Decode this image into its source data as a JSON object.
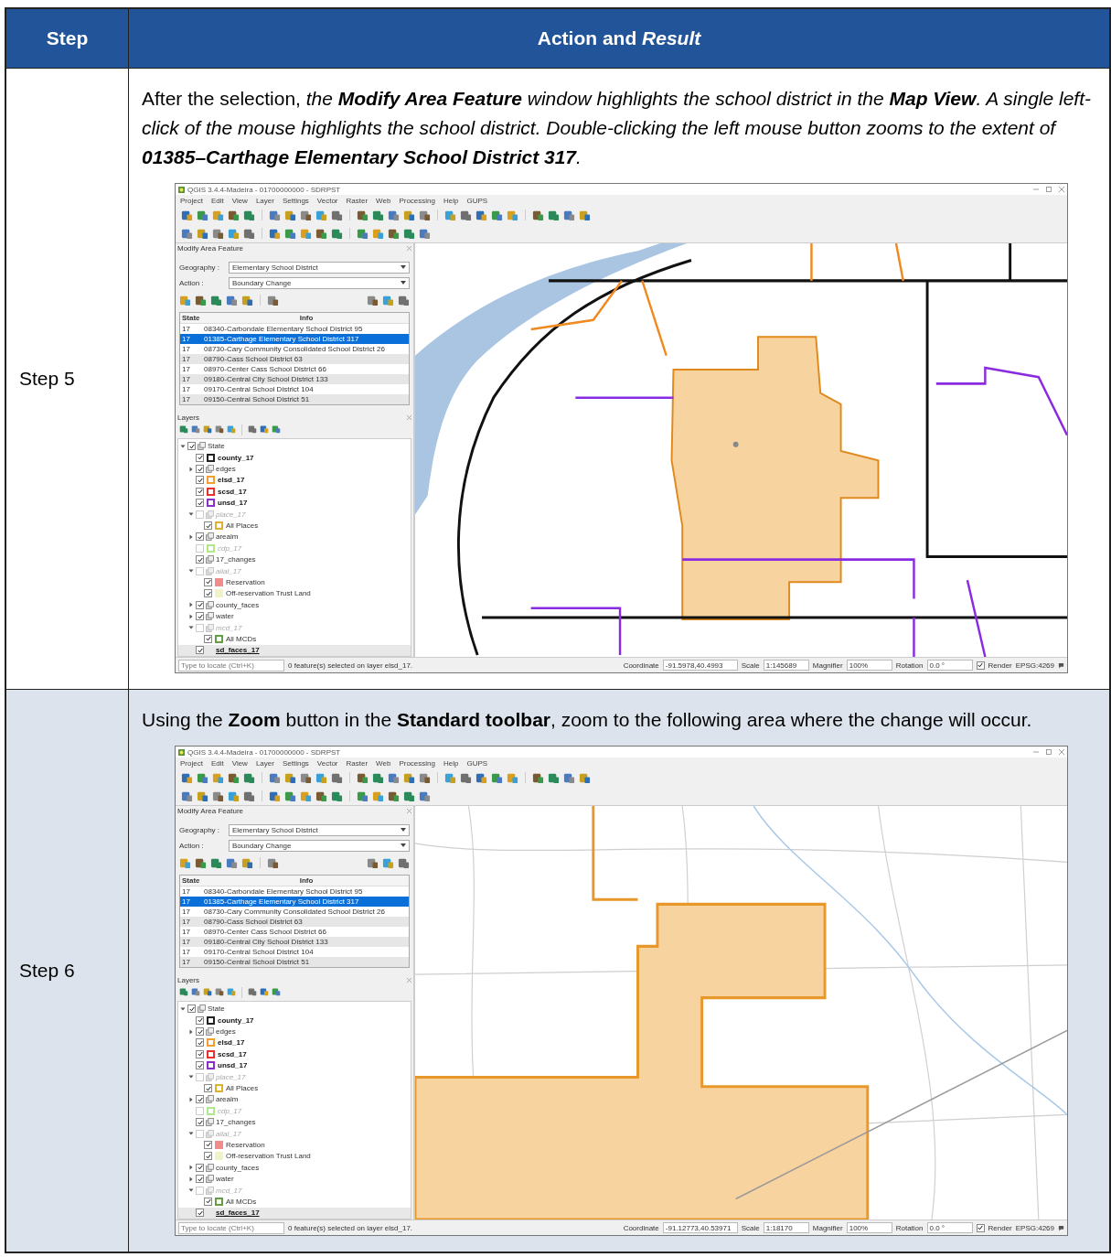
{
  "header": {
    "step": "Step",
    "action": "Action and *Result*"
  },
  "steps": [
    {
      "label": "Step 5",
      "shaded": false,
      "text": [
        {
          "text": "After the selection, ",
          "bold": false,
          "italic": false
        },
        {
          "text": "the ",
          "bold": false,
          "italic": true
        },
        {
          "text": "Modify Area Feature",
          "bold": true,
          "italic": true
        },
        {
          "text": " window highlights the school district in the ",
          "bold": false,
          "italic": true
        },
        {
          "text": "Map View",
          "bold": true,
          "italic": true
        },
        {
          "text": ". A single left-click of the mouse highlights the school district. Double-clicking the left mouse button zooms to the extent of ",
          "bold": false,
          "italic": true
        },
        {
          "text": "01385–Carthage Elementary School District 317",
          "bold": true,
          "italic": true
        },
        {
          "text": ".",
          "bold": false,
          "italic": true
        }
      ],
      "screenshot": {
        "window_title": "QGIS 3.4.4-Madeira - 01700000000 - SDRPST",
        "menu": [
          "Project",
          "Edit",
          "View",
          "Layer",
          "Settings",
          "Vector",
          "Raster",
          "Web",
          "Processing",
          "Help",
          "GUPS"
        ],
        "dock_title": "Modify Area Feature",
        "geography_label": "Geography :",
        "geography": "Elementary School District",
        "action_label": "Action :",
        "action": "Boundary Change",
        "columns": [
          "State",
          "Info"
        ],
        "rows": [
          {
            "state": "17",
            "info": "08340-Carbondale Elementary School District 95",
            "selected": false
          },
          {
            "state": "17",
            "info": "01385-Carthage Elementary School District 317",
            "selected": true
          },
          {
            "state": "17",
            "info": "08730-Cary Community Consolidated School District 26",
            "selected": false
          },
          {
            "state": "17",
            "info": "08790-Cass School District 63",
            "selected": false
          },
          {
            "state": "17",
            "info": "08970-Center Cass School District 66",
            "selected": false
          },
          {
            "state": "17",
            "info": "09180-Central City School District 133",
            "selected": false
          },
          {
            "state": "17",
            "info": "09170-Central School District 104",
            "selected": false
          },
          {
            "state": "17",
            "info": "09150-Central School District 51",
            "selected": false
          }
        ],
        "layers_title": "Layers",
        "layers": [
          {
            "name": "State",
            "kind": "group",
            "checked": true,
            "expanded": true,
            "enabled": true,
            "bold": false,
            "selected": false,
            "children": [
              {
                "name": "county_17",
                "kind": "symbol",
                "color": "#222222",
                "filled": false,
                "checked": true,
                "enabled": true,
                "bold": true,
                "selected": false
              },
              {
                "name": "edges",
                "kind": "group",
                "checked": true,
                "expanded": false,
                "enabled": true,
                "bold": false,
                "selected": false
              },
              {
                "name": "elsd_17",
                "kind": "symbol",
                "color": "#f0a030",
                "filled": false,
                "checked": true,
                "enabled": true,
                "bold": true,
                "selected": false
              },
              {
                "name": "scsd_17",
                "kind": "symbol",
                "color": "#e83030",
                "filled": false,
                "checked": true,
                "enabled": true,
                "bold": true,
                "selected": false
              },
              {
                "name": "unsd_17",
                "kind": "symbol",
                "color": "#8a30c8",
                "filled": false,
                "checked": true,
                "enabled": true,
                "bold": true,
                "selected": false
              },
              {
                "name": "place_17",
                "kind": "group",
                "checked": false,
                "expanded": true,
                "enabled": false,
                "bold": false,
                "selected": false,
                "children": [
                  {
                    "name": "All Places",
                    "kind": "symbol",
                    "color": "#e0b030",
                    "filled": false,
                    "checked": true,
                    "enabled": true,
                    "bold": false,
                    "selected": false
                  }
                ]
              },
              {
                "name": "arealm",
                "kind": "group",
                "checked": true,
                "expanded": false,
                "enabled": true,
                "bold": false,
                "selected": false
              },
              {
                "name": "cdp_17",
                "kind": "symbol",
                "color": "#b0e890",
                "filled": false,
                "checked": false,
                "enabled": false,
                "bold": false,
                "selected": false
              },
              {
                "name": "17_changes",
                "kind": "group",
                "checked": true,
                "enabled": true,
                "bold": false,
                "selected": false
              },
              {
                "name": "aiial_17",
                "kind": "group",
                "checked": false,
                "expanded": true,
                "enabled": false,
                "bold": false,
                "selected": false,
                "children": [
                  {
                    "name": "Reservation",
                    "kind": "symbol",
                    "color": "#f08c8c",
                    "filled": true,
                    "checked": true,
                    "enabled": true,
                    "bold": false,
                    "selected": false
                  },
                  {
                    "name": "Off-reservation Trust Land",
                    "kind": "symbol",
                    "color": "#f2f2c8",
                    "filled": true,
                    "checked": true,
                    "enabled": true,
                    "bold": false,
                    "selected": false
                  }
                ]
              },
              {
                "name": "county_faces",
                "kind": "group",
                "checked": true,
                "expanded": false,
                "enabled": true,
                "bold": false,
                "selected": false
              },
              {
                "name": "water",
                "kind": "group",
                "checked": true,
                "expanded": false,
                "enabled": true,
                "bold": false,
                "selected": false
              },
              {
                "name": "mcd_17",
                "kind": "group",
                "checked": false,
                "expanded": true,
                "enabled": false,
                "bold": false,
                "selected": false,
                "children": [
                  {
                    "name": "All MCDs",
                    "kind": "symbol",
                    "color": "#60a040",
                    "filled": false,
                    "checked": true,
                    "enabled": true,
                    "bold": false,
                    "selected": false
                  }
                ]
              },
              {
                "name": "sd_faces_17",
                "kind": "plain",
                "checked": true,
                "enabled": true,
                "bold": true,
                "selected": true
              }
            ]
          }
        ],
        "status": {
          "locate_placeholder": "Type to locate (Ctrl+K)",
          "message": "0 feature(s) selected on layer elsd_17.",
          "coordinate_label": "Coordinate",
          "coordinate": "-91.5978,40.4993",
          "scale_label": "Scale",
          "scale": "1:145689",
          "magnifier_label": "Magnifier",
          "magnifier": "100%",
          "rotation_label": "Rotation",
          "rotation": "0.0 °",
          "render_label": "Render",
          "render_checked": true,
          "crs": "EPSG:4269"
        }
      }
    },
    {
      "label": "Step 6",
      "shaded": true,
      "text": [
        {
          "text": "Using the ",
          "bold": false,
          "italic": false
        },
        {
          "text": "Zoom",
          "bold": true,
          "italic": false
        },
        {
          "text": " button in the ",
          "bold": false,
          "italic": false
        },
        {
          "text": "Standard toolbar",
          "bold": true,
          "italic": false
        },
        {
          "text": ", zoom to the following area where the change will occur.",
          "bold": false,
          "italic": false
        }
      ],
      "screenshot": {
        "window_title": "QGIS 3.4.4-Madeira - 01700000000 - SDRPST",
        "menu": [
          "Project",
          "Edit",
          "View",
          "Layer",
          "Settings",
          "Vector",
          "Raster",
          "Web",
          "Processing",
          "Help",
          "GUPS"
        ],
        "dock_title": "Modify Area Feature",
        "geography_label": "Geography :",
        "geography": "Elementary School District",
        "action_label": "Action :",
        "action": "Boundary Change",
        "columns": [
          "State",
          "Info"
        ],
        "rows": [
          {
            "state": "17",
            "info": "08340-Carbondale Elementary School District 95",
            "selected": false
          },
          {
            "state": "17",
            "info": "01385-Carthage Elementary School District 317",
            "selected": true
          },
          {
            "state": "17",
            "info": "08730-Cary Community Consolidated School District 26",
            "selected": false
          },
          {
            "state": "17",
            "info": "08790-Cass School District 63",
            "selected": false
          },
          {
            "state": "17",
            "info": "08970-Center Cass School District 66",
            "selected": false
          },
          {
            "state": "17",
            "info": "09180-Central City School District 133",
            "selected": false
          },
          {
            "state": "17",
            "info": "09170-Central School District 104",
            "selected": false
          },
          {
            "state": "17",
            "info": "09150-Central School District 51",
            "selected": false
          }
        ],
        "layers_title": "Layers",
        "layers": [
          {
            "name": "State",
            "kind": "group",
            "checked": true,
            "expanded": true,
            "enabled": true,
            "bold": false,
            "selected": false,
            "children": [
              {
                "name": "county_17",
                "kind": "symbol",
                "color": "#222222",
                "filled": false,
                "checked": true,
                "enabled": true,
                "bold": true,
                "selected": false
              },
              {
                "name": "edges",
                "kind": "group",
                "checked": true,
                "expanded": false,
                "enabled": true,
                "bold": false,
                "selected": false
              },
              {
                "name": "elsd_17",
                "kind": "symbol",
                "color": "#f0a030",
                "filled": false,
                "checked": true,
                "enabled": true,
                "bold": true,
                "selected": false
              },
              {
                "name": "scsd_17",
                "kind": "symbol",
                "color": "#e83030",
                "filled": false,
                "checked": true,
                "enabled": true,
                "bold": true,
                "selected": false
              },
              {
                "name": "unsd_17",
                "kind": "symbol",
                "color": "#8a30c8",
                "filled": false,
                "checked": true,
                "enabled": true,
                "bold": true,
                "selected": false
              },
              {
                "name": "place_17",
                "kind": "group",
                "checked": false,
                "expanded": true,
                "enabled": false,
                "bold": false,
                "selected": false,
                "children": [
                  {
                    "name": "All Places",
                    "kind": "symbol",
                    "color": "#e0b030",
                    "filled": false,
                    "checked": true,
                    "enabled": true,
                    "bold": false,
                    "selected": false
                  }
                ]
              },
              {
                "name": "arealm",
                "kind": "group",
                "checked": true,
                "expanded": false,
                "enabled": true,
                "bold": false,
                "selected": false
              },
              {
                "name": "cdp_17",
                "kind": "symbol",
                "color": "#b0e890",
                "filled": false,
                "checked": false,
                "enabled": false,
                "bold": false,
                "selected": false
              },
              {
                "name": "17_changes",
                "kind": "group",
                "checked": true,
                "enabled": true,
                "bold": false,
                "selected": false
              },
              {
                "name": "aiial_17",
                "kind": "group",
                "checked": false,
                "expanded": true,
                "enabled": false,
                "bold": false,
                "selected": false,
                "children": [
                  {
                    "name": "Reservation",
                    "kind": "symbol",
                    "color": "#f08c8c",
                    "filled": true,
                    "checked": true,
                    "enabled": true,
                    "bold": false,
                    "selected": false
                  },
                  {
                    "name": "Off-reservation Trust Land",
                    "kind": "symbol",
                    "color": "#f2f2c8",
                    "filled": true,
                    "checked": true,
                    "enabled": true,
                    "bold": false,
                    "selected": false
                  }
                ]
              },
              {
                "name": "county_faces",
                "kind": "group",
                "checked": true,
                "expanded": false,
                "enabled": true,
                "bold": false,
                "selected": false
              },
              {
                "name": "water",
                "kind": "group",
                "checked": true,
                "expanded": false,
                "enabled": true,
                "bold": false,
                "selected": false
              },
              {
                "name": "mcd_17",
                "kind": "group",
                "checked": false,
                "expanded": true,
                "enabled": false,
                "bold": false,
                "selected": false,
                "children": [
                  {
                    "name": "All MCDs",
                    "kind": "symbol",
                    "color": "#60a040",
                    "filled": false,
                    "checked": true,
                    "enabled": true,
                    "bold": false,
                    "selected": false
                  }
                ]
              },
              {
                "name": "sd_faces_17",
                "kind": "plain",
                "checked": true,
                "enabled": true,
                "bold": true,
                "selected": true
              }
            ]
          }
        ],
        "status": {
          "locate_placeholder": "Type to locate (Ctrl+K)",
          "message": "0 feature(s) selected on layer elsd_17.",
          "coordinate_label": "Coordinate",
          "coordinate": "-91.12773,40.53971",
          "scale_label": "Scale",
          "scale": "1:18170",
          "magnifier_label": "Magnifier",
          "magnifier": "100%",
          "rotation_label": "Rotation",
          "rotation": "0.0 °",
          "render_label": "Render",
          "render_checked": true,
          "crs": "EPSG:4269"
        }
      }
    }
  ]
}
